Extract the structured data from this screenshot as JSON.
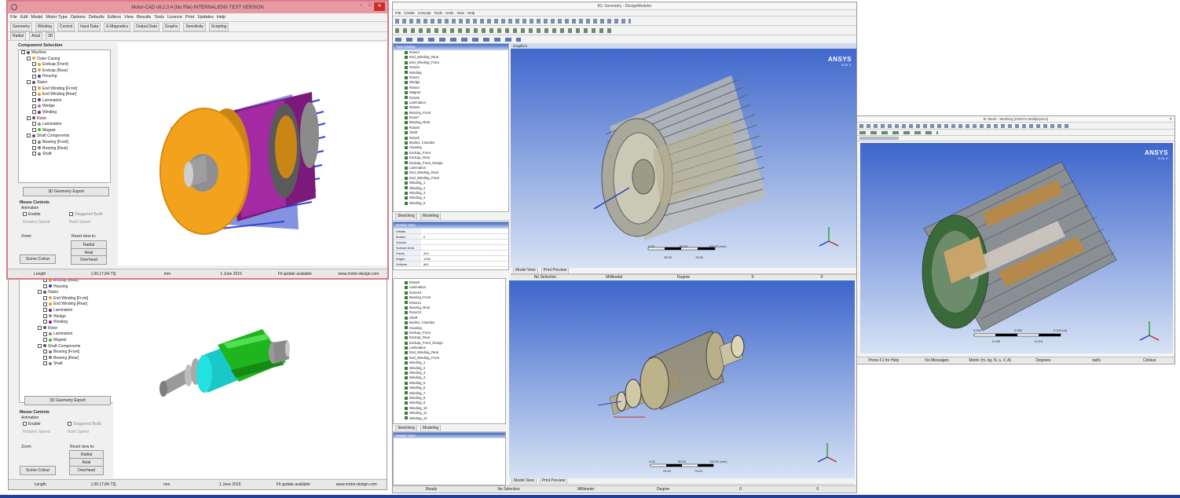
{
  "motorcad": {
    "title": "Motor-CAD v8.2.3.4 (No File) INTERNAL/ENV TEST VERSION",
    "menu": [
      "File",
      "Edit",
      "Model",
      "Motor Type",
      "Options",
      "Defaults",
      "Editors",
      "View",
      "Results",
      "Tools",
      "Licence",
      "Print",
      "Updates",
      "Help"
    ],
    "tabs_row": [
      "Geometry",
      "Winding",
      "Control",
      "Input Data",
      "E-Magnetics",
      "Output Data",
      "Graphs",
      "Sensitivity",
      "Scripting"
    ],
    "sub_tabs": [
      "Radial",
      "Axial",
      "3D"
    ],
    "component_header": "Component Selection",
    "tree_top": [
      "Machine",
      "Outer Casing",
      "Endcap [Front]",
      "Endcap [Rear]",
      "Housing",
      "Stator",
      "End Winding [Front]",
      "End Winding [Rear]",
      "Lamination",
      "Wedge",
      "Winding",
      "Rotor",
      "Lamination",
      "Magnet",
      "Shaft Components",
      "Bearing [Front]",
      "Bearing [Rear]",
      "Shaft"
    ],
    "tree_bottom": [
      "Endcap [Rear]",
      "Housing",
      "Stator",
      "End Winding [Front]",
      "End Winding [Rear]",
      "Lamination",
      "Wedge",
      "Winding",
      "Rotor",
      "Lamination",
      "Magnet",
      "Shaft Components",
      "Bearing [Front]",
      "Bearing [Rear]",
      "Shaft"
    ],
    "export_btn": "3D Geometry Export",
    "mouse_controls": "Mouse Controls",
    "animation": "Animation",
    "enable": "Enable",
    "staggered": "Staggered Build",
    "rotation_speed": "Rotation Speed",
    "build_speed": "Build Speed",
    "zoom": "Zoom",
    "reset_view": "Reset view to:",
    "radial": "Radial",
    "axial": "Axial",
    "scene_colour": "Scene Colour",
    "overhead": "Overhead",
    "status": [
      "Length",
      "[-30.17,84.73]",
      "mm",
      "1 June 2015",
      "Fit update available",
      "www.motor-design.com"
    ]
  },
  "ansys1": {
    "title": "B2: Geometry - DesignModeler",
    "menu": [
      "File",
      "Create",
      "Concept",
      "Tools",
      "Units",
      "View",
      "Help"
    ],
    "tree_header": "Tree Outline",
    "tree": [
      "Rotor3",
      "End_Winding_Rear",
      "End_Winding_Front",
      "Rotor2",
      "Winding",
      "Rotor1",
      "Wedge",
      "Rotor4",
      "Magnet",
      "Rotor5",
      "Lamination",
      "Rotor6",
      "Bearing_Front",
      "Rotor7",
      "Bearing_Rear",
      "Rotor8",
      "Shaft",
      "Rotor9",
      "Bodies, 3 Bodies",
      "Housing",
      "Endcap_Front",
      "Endcap_Rear",
      "Endcap_Front_Design",
      "Lamination",
      "End_Winding_Rear",
      "End_Winding_Front",
      "Winding_1",
      "Winding_2",
      "Winding_3",
      "Winding_4",
      "Winding_5"
    ],
    "tabs": [
      "Sketching",
      "Modeling"
    ],
    "details_header": "Details View",
    "graphics_header": "Graphics",
    "details_rows": [
      [
        "Details",
        ""
      ],
      [
        "Bodies",
        "0"
      ],
      [
        "Volume",
        ""
      ],
      [
        "Surface Area",
        ""
      ],
      [
        "Faces",
        "263"
      ],
      [
        "Edges",
        "1098"
      ],
      [
        "Vertices",
        "882"
      ]
    ],
    "scale": [
      "0.00",
      "50.00",
      "100.00 (mm)",
      "25.00",
      "75.00"
    ],
    "status": [
      "No Selection",
      "Millimeter",
      "Degree",
      "0",
      "0"
    ],
    "view_tabs": [
      "Model View",
      "Print Preview"
    ]
  },
  "ansys2": {
    "tree": [
      "Rotor9",
      "Lamination",
      "Rotor10",
      "Bearing_Front",
      "Rotor11",
      "Bearing_Rear",
      "Rotor12",
      "Shaft",
      "Bodies, 3 Bodies",
      "Housing",
      "Endcap_Front",
      "Endcap_Rear",
      "Endcap_Front_Design",
      "Lamination",
      "End_Winding_Rear",
      "End_Winding_Front",
      "Winding_1",
      "Winding_2",
      "Winding_3",
      "Winding_4",
      "Winding_5",
      "Winding_6",
      "Winding_7",
      "Winding_8",
      "Winding_9",
      "Winding_10",
      "Winding_11",
      "Winding_12"
    ],
    "tabs": [
      "Sketching",
      "Modeling"
    ],
    "details_header": "Details View",
    "scale": [
      "0.00",
      "50.00",
      "100.00 (mm)",
      "25.00",
      "75.00"
    ],
    "status": [
      "Ready",
      "No Selection",
      "Millimeter",
      "Degree",
      "0",
      "0"
    ],
    "view_tabs": [
      "Model View",
      "Print Preview"
    ]
  },
  "ansys3": {
    "title": "B: Mesh - Meshing [ANSYS Multiphysics]",
    "logo": "ANSYS",
    "version": "R16.0",
    "scale": [
      "0.000",
      "0.050",
      "0.100 (m)",
      "0.025",
      "0.075"
    ],
    "status": [
      "Press F1 for Help",
      "No Messages",
      "Metric (m, kg, N, s, V, A)",
      "Degrees",
      "rad/s",
      "Celsius"
    ]
  },
  "logos": {
    "ansys": "ANSYS",
    "ver": "R16.0"
  },
  "colors": {
    "motorcad_border": "#d97a86",
    "ansys_bg_top": "#3f68c9",
    "ansys_bg_bottom": "#c8d8f0",
    "orange": "#f2a21c",
    "purple": "#8a1a8a",
    "green": "#2fc22f",
    "cyan": "#1fdede"
  }
}
